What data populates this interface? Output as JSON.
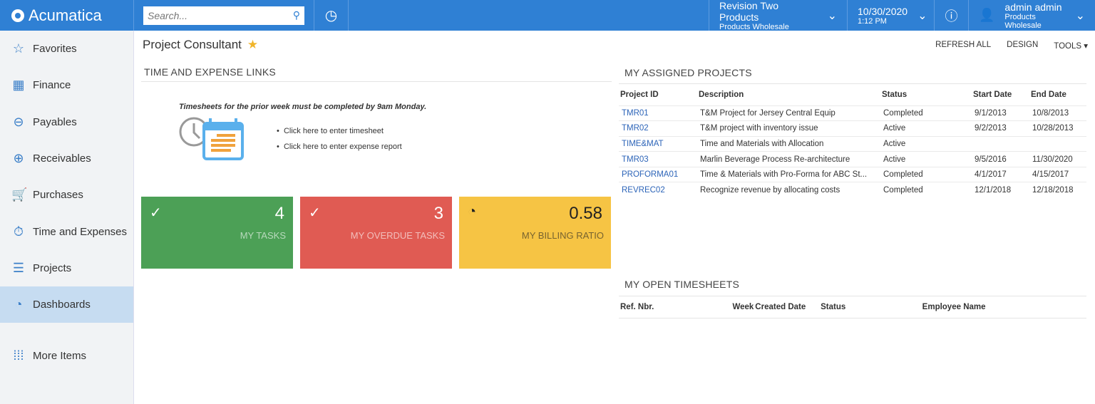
{
  "header": {
    "brand": "Acumatica",
    "search_placeholder": "Search...",
    "company": "Revision Two Products",
    "branch": "Products Wholesale",
    "date": "10/30/2020",
    "time": "1:12 PM",
    "user": "admin admin",
    "user_branch": "Products Wholesale"
  },
  "sidebar": {
    "items": [
      {
        "label": "Favorites",
        "icon": "☆"
      },
      {
        "label": "Finance",
        "icon": "▦"
      },
      {
        "label": "Payables",
        "icon": "⊖"
      },
      {
        "label": "Receivables",
        "icon": "⊕"
      },
      {
        "label": "Purchases",
        "icon": "🛒"
      },
      {
        "label": "Time and Expenses",
        "icon": "⏱"
      },
      {
        "label": "Projects",
        "icon": "☰"
      },
      {
        "label": "Dashboards",
        "icon": "◔"
      }
    ],
    "more": "More Items"
  },
  "page": {
    "title": "Project Consultant",
    "toolbar": {
      "refresh": "REFRESH ALL",
      "design": "DESIGN",
      "tools": "TOOLS ▾"
    }
  },
  "time_expense": {
    "title": "TIME AND EXPENSE LINKS",
    "note": "Timesheets for the prior week must be completed by 9am Monday.",
    "links": [
      "Click here to enter timesheet",
      "Click here to enter expense report"
    ]
  },
  "tiles": [
    {
      "value": "4",
      "label": "MY TASKS",
      "color": "#4ca056",
      "icon": "✓"
    },
    {
      "value": "3",
      "label": "MY OVERDUE TASKS",
      "color": "#e05b53",
      "icon": "✓"
    },
    {
      "value": "0.58",
      "label": "MY BILLING RATIO",
      "color": "#f6c444",
      "icon": "◔"
    }
  ],
  "projects": {
    "title": "MY ASSIGNED PROJECTS",
    "columns": [
      "Project ID",
      "Description",
      "Status",
      "Start Date",
      "End Date"
    ],
    "rows": [
      [
        "TMR01",
        "T&M Project for Jersey Central Equip",
        "Completed",
        "9/1/2013",
        "10/8/2013"
      ],
      [
        "TMR02",
        "T&M project with inventory issue",
        "Active",
        "9/2/2013",
        "10/28/2013"
      ],
      [
        "TIME&MAT",
        "Time and Materials with Allocation",
        "Active",
        "",
        ""
      ],
      [
        "TMR03",
        "Marlin Beverage Process Re-architecture",
        "Active",
        "9/5/2016",
        "11/30/2020"
      ],
      [
        "PROFORMA01",
        "Time & Materials with Pro-Forma for ABC St...",
        "Completed",
        "4/1/2017",
        "4/15/2017"
      ],
      [
        "REVREC02",
        "Recognize revenue by allocating costs",
        "Completed",
        "12/1/2018",
        "12/18/2018"
      ]
    ]
  },
  "timesheets": {
    "title": "MY OPEN TIMESHEETS",
    "columns": [
      "Ref. Nbr.",
      "Week",
      "Created Date",
      "Status",
      "Employee Name"
    ]
  }
}
